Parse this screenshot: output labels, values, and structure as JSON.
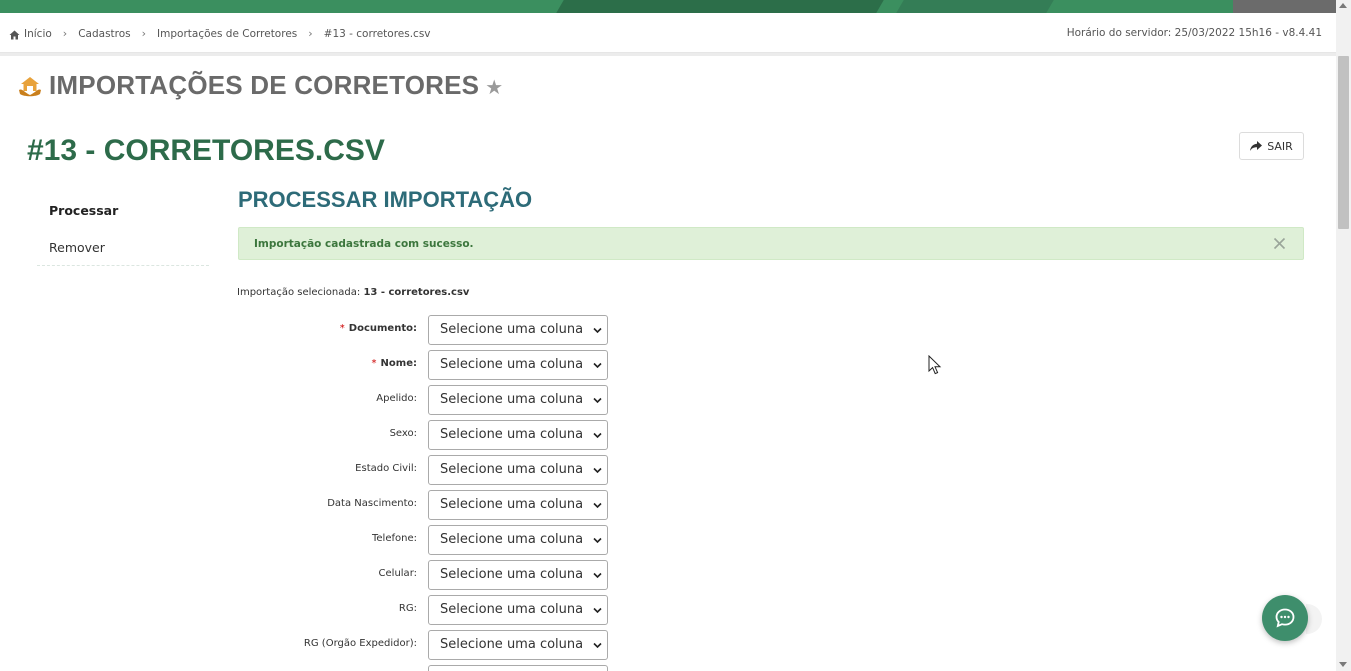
{
  "colors": {
    "topbar": "#3b8f5f",
    "record_title": "#2d6b4a",
    "section_title": "#2d6b78",
    "alert_bg": "#dff0d8",
    "alert_text": "#3c763d",
    "chat": "#3e8e6c",
    "required_star": "#cc0000"
  },
  "breadcrumb": {
    "icon": "home-icon",
    "items": [
      "Início",
      "Cadastros",
      "Importações de Corretores",
      "#13 - corretores.csv"
    ]
  },
  "server_time": "Horário do servidor: 25/03/2022 15h16 - v8.4.41",
  "page": {
    "title": "IMPORTAÇÕES DE CORRETORES",
    "logo_icon": "hands-house-icon",
    "favorite_icon": "star-icon"
  },
  "record": {
    "title": "#13 - CORRETORES.CSV",
    "exit_label": "SAIR",
    "exit_icon": "share-arrow-icon"
  },
  "side_nav": {
    "items": [
      {
        "label": "Processar",
        "active": true
      },
      {
        "label": "Remover",
        "active": false
      }
    ]
  },
  "section": {
    "title": "PROCESSAR IMPORTAÇÃO"
  },
  "alert": {
    "message": "Importação cadastrada com sucesso.",
    "close_icon": "close-icon"
  },
  "selection": {
    "label": "Importação selecionada:",
    "value": "13 - corretores.csv"
  },
  "form": {
    "fields": [
      {
        "label": "Documento:",
        "required": true,
        "value": "Selecione uma coluna"
      },
      {
        "label": "Nome:",
        "required": true,
        "value": "Selecione uma coluna"
      },
      {
        "label": "Apelido:",
        "required": false,
        "value": "Selecione uma coluna"
      },
      {
        "label": "Sexo:",
        "required": false,
        "value": "Selecione uma coluna"
      },
      {
        "label": "Estado Civil:",
        "required": false,
        "value": "Selecione uma coluna"
      },
      {
        "label": "Data Nascimento:",
        "required": false,
        "value": "Selecione uma coluna"
      },
      {
        "label": "Telefone:",
        "required": false,
        "value": "Selecione uma coluna"
      },
      {
        "label": "Celular:",
        "required": false,
        "value": "Selecione uma coluna"
      },
      {
        "label": "RG:",
        "required": false,
        "value": "Selecione uma coluna"
      },
      {
        "label": "RG (Orgão Expedidor):",
        "required": false,
        "value": "Selecione uma coluna"
      }
    ]
  },
  "chat": {
    "icon": "chat-bubble-icon"
  }
}
